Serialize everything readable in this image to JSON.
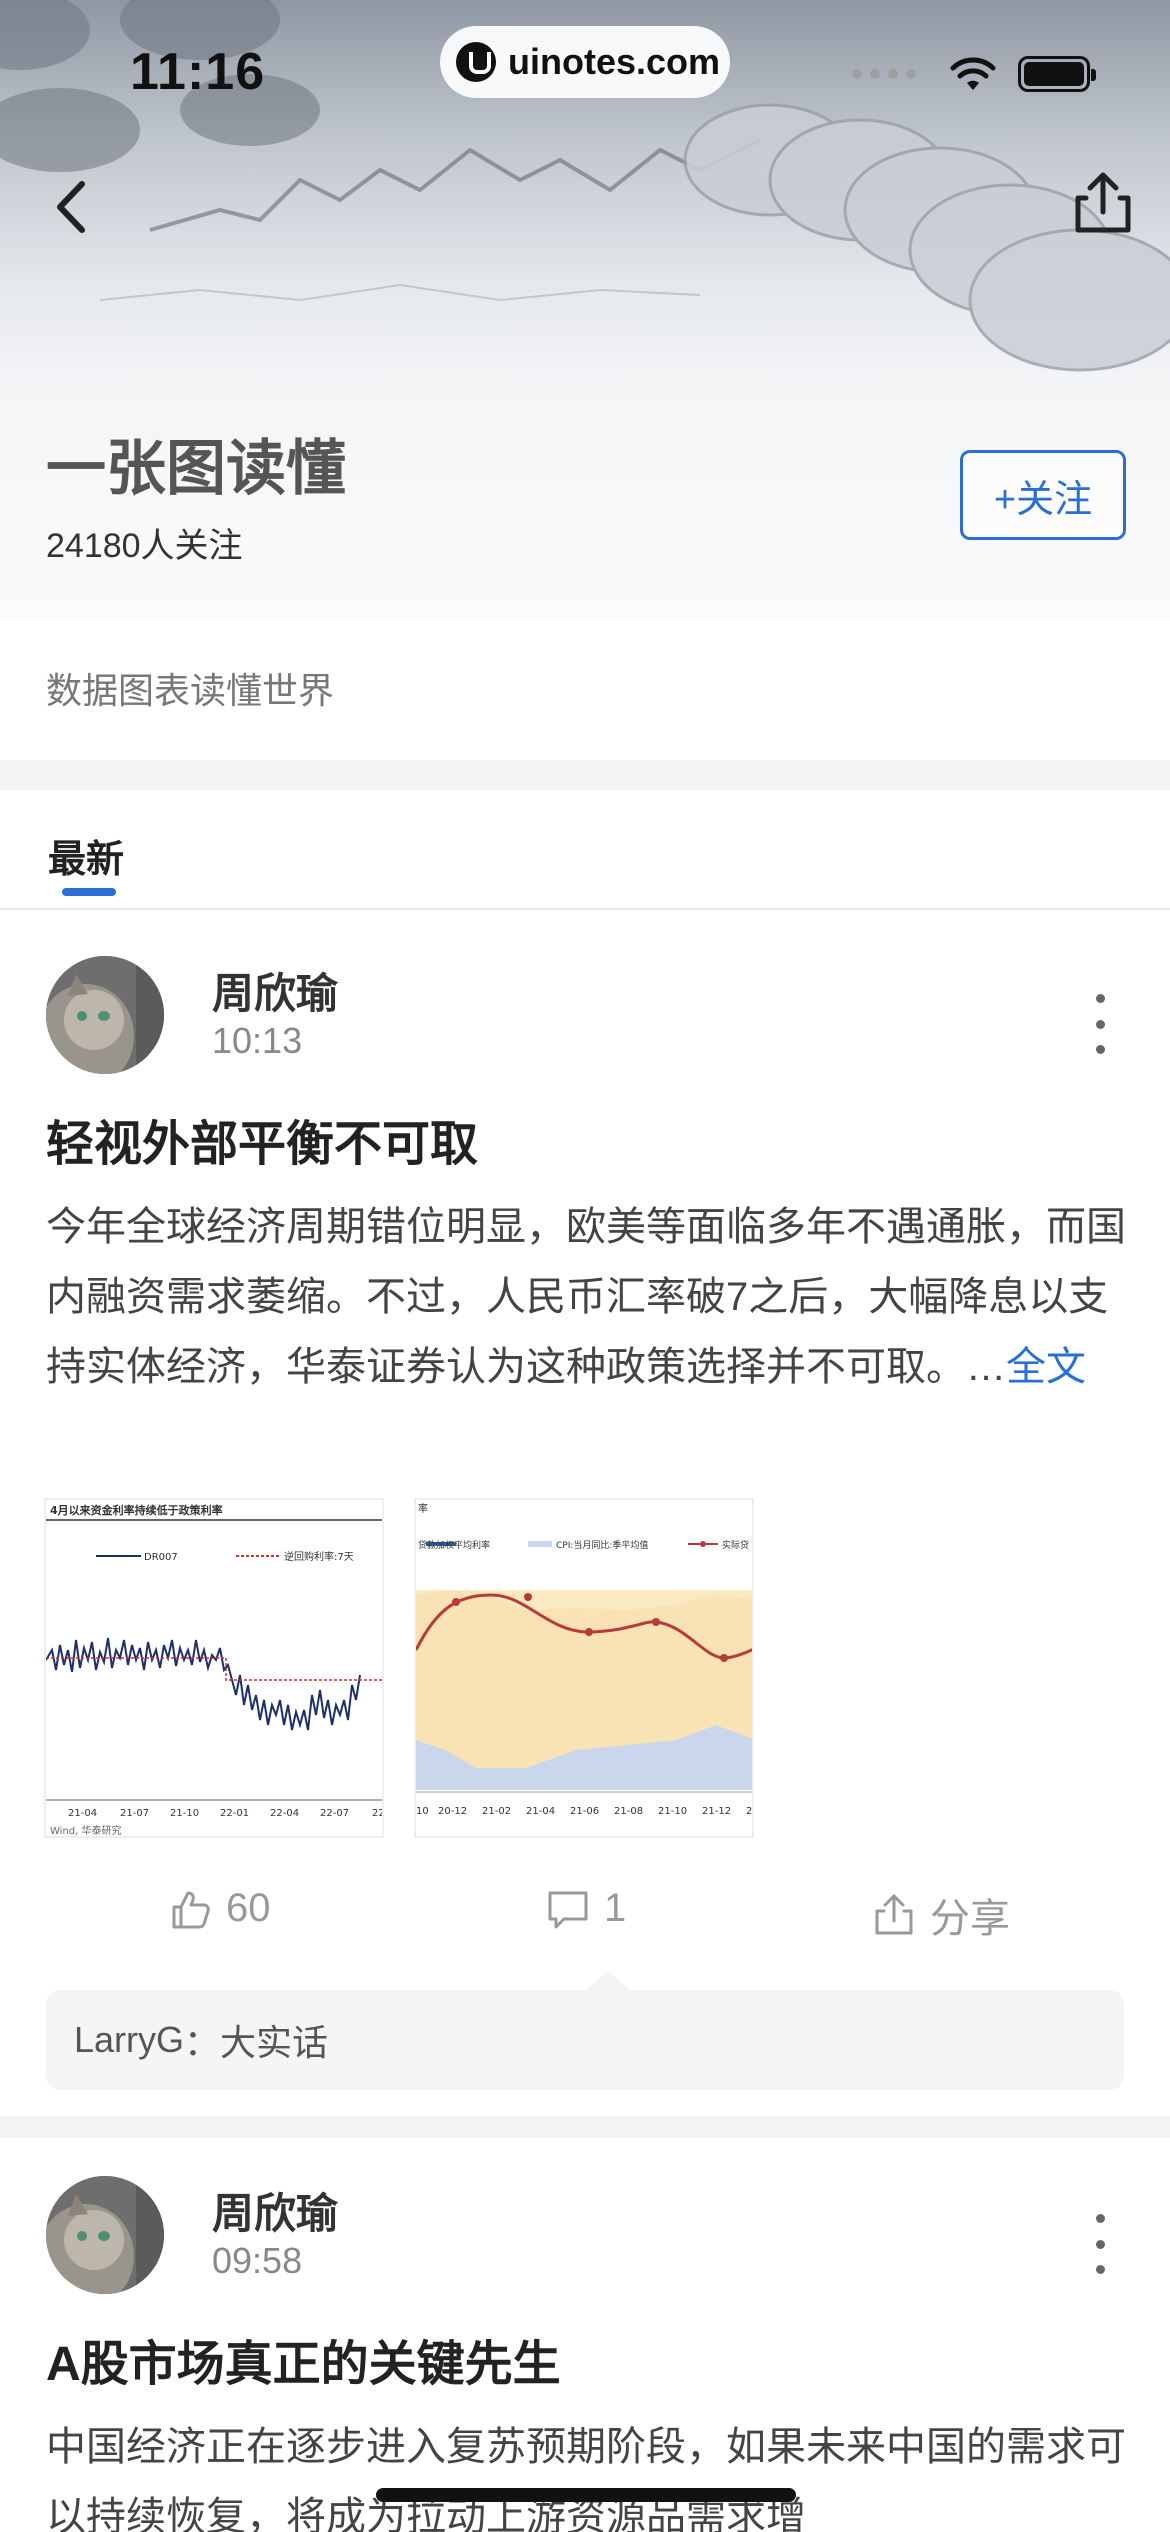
{
  "status_bar": {
    "time": "11:16",
    "url": "uinotes.com"
  },
  "topic": {
    "title": "一张图读懂",
    "followers": "24180人关注",
    "follow_label": "+关注",
    "description": "数据图表读懂世界"
  },
  "tabs": [
    {
      "label": "最新",
      "active": true
    }
  ],
  "posts": [
    {
      "author": "周欣瑜",
      "time": "10:13",
      "title": "轻视外部平衡不可取",
      "body": "今年全球经济周期错位明显，欧美等面临多年不遇通胀，而国内融资需求萎缩。不过，人民币汇率破7之后，大幅降息以支持实体经济，华泰证券认为这种政策选择并不可取。",
      "ellipsis": "…",
      "more_label": "全文",
      "thumb1": {
        "title": "4月以来资金利率持续低于政策利率",
        "legend": [
          "DR007",
          "逆回购利率:7天"
        ],
        "xticks": [
          "21-04",
          "21-07",
          "21-10",
          "22-01",
          "22-04",
          "22-07",
          "22"
        ],
        "source": "Wind, 华泰研究"
      },
      "thumb2": {
        "title_fragment": "率",
        "legend": [
          "贷款加权平均利率",
          "CPI:当月同比:季平均值",
          "实际贷"
        ],
        "xticks": [
          "10",
          "20-12",
          "21-02",
          "21-04",
          "21-06",
          "21-08",
          "21-10",
          "21-12",
          "2"
        ]
      },
      "likes": "60",
      "comments": "1",
      "share_label": "分享",
      "top_comment": {
        "user": "LarryG",
        "sep": "：",
        "text": "大实话"
      }
    },
    {
      "author": "周欣瑜",
      "time": "09:58",
      "title": "A股市场真正的关键先生",
      "body": "中国经济正在逐步进入复苏预期阶段，如果未来中国的需求可以持续恢复，将成为拉动上游资源品需求增"
    }
  ],
  "colors": {
    "accent": "#2a6fd6",
    "text": "#222222",
    "muted": "#888888"
  },
  "icons": {
    "back": "chevron-left-icon",
    "share": "share-icon",
    "like": "thumbs-up-icon",
    "comment": "comment-icon",
    "more": "more-vertical-icon",
    "wifi": "wifi-icon",
    "battery": "battery-icon"
  }
}
